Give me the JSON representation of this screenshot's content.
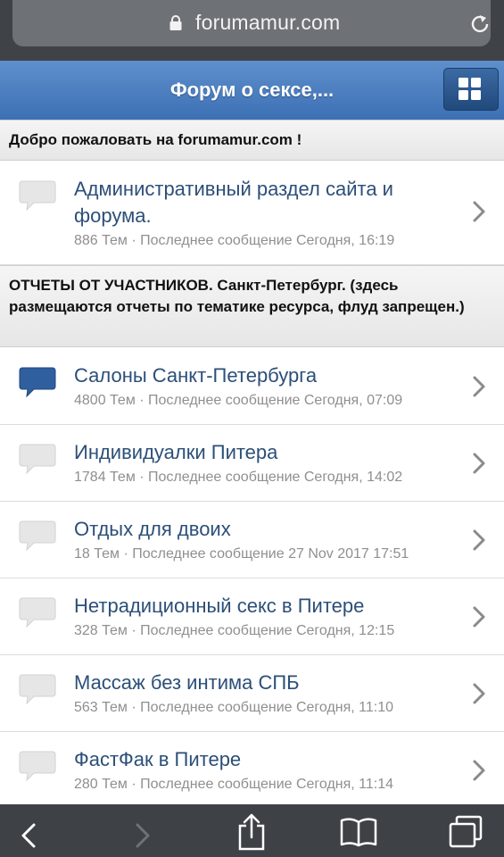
{
  "browser": {
    "url": "forumamur.com",
    "lock_icon": "lock-icon",
    "reload_icon": "reload-icon"
  },
  "header": {
    "title": "Форум о сексе,...",
    "menu_icon": "grid-menu-icon"
  },
  "categories": [
    {
      "title": "Добро пожаловать на forumamur.com !"
    },
    {
      "title": "ОТЧЕТЫ ОТ УЧАСТНИКОВ. Санкт-Петербург. (здесь размещаются отчеты по тематике ресурса, флуд запрещен.)"
    }
  ],
  "forums": [
    {
      "title_line1": "Административный раздел сайта и",
      "title_line2": "форума.",
      "meta": "886 Тем · Последнее сообщение Сегодня, 16:19",
      "unread": false
    },
    {
      "title": "Салоны Санкт-Петербурга",
      "meta": "4800 Тем · Последнее сообщение Сегодня, 07:09",
      "unread": true
    },
    {
      "title": "Индивидуалки Питера",
      "meta": "1784 Тем · Последнее сообщение Сегодня, 14:02",
      "unread": false
    },
    {
      "title": "Отдых для двоих",
      "meta": "18 Тем · Последнее сообщение 27 Nov 2017 17:51",
      "unread": false
    },
    {
      "title": "Нетрадиционный секс в Питере",
      "meta": "328 Тем · Последнее сообщение Сегодня, 12:15",
      "unread": false
    },
    {
      "title": "Массаж без интима СПБ",
      "meta": "563 Тем · Последнее сообщение Сегодня, 11:10",
      "unread": false
    },
    {
      "title": "ФастФак в Питере",
      "meta": "280 Тем · Последнее сообщение Сегодня, 11:14",
      "unread": false
    }
  ],
  "colors": {
    "header_blue": "#3c70b4",
    "link_blue": "#2c4f78",
    "unread_bubble": "#2f5f9e",
    "read_bubble": "#e6e6e6"
  },
  "toolbar": {
    "icons": [
      "back-icon",
      "forward-icon",
      "share-icon",
      "bookmarks-icon",
      "tabs-icon"
    ]
  }
}
